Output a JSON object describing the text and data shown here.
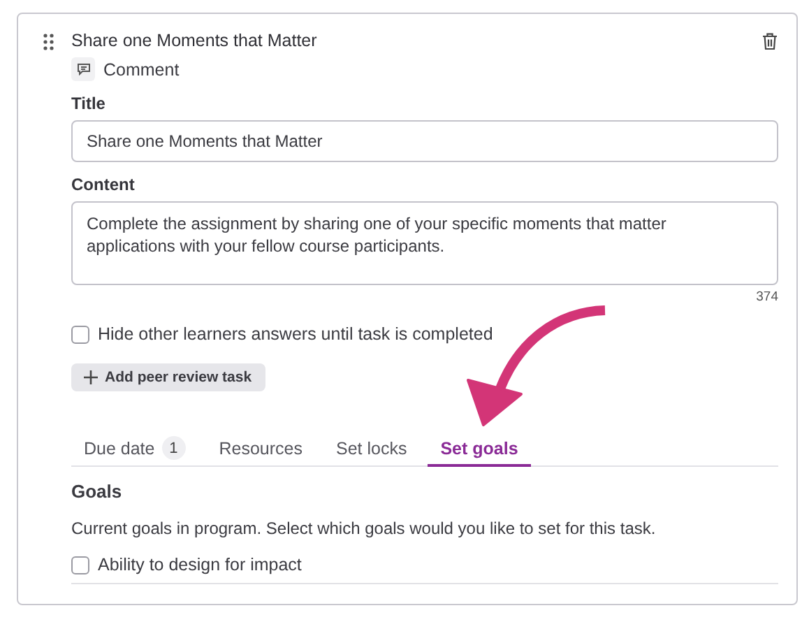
{
  "header": {
    "title": "Share one Moments that Matter",
    "type_label": "Comment"
  },
  "title_field": {
    "label": "Title",
    "value": "Share one Moments that Matter"
  },
  "content_field": {
    "label": "Content",
    "value": "Complete the assignment by sharing one of your specific moments that matter applications with your fellow course participants.",
    "count": "374"
  },
  "hide_answers": {
    "label": "Hide other learners answers until task is completed",
    "checked": false
  },
  "add_button": {
    "label": "Add peer review task"
  },
  "tabs": [
    {
      "label": "Due date",
      "badge": "1",
      "selected": false
    },
    {
      "label": "Resources",
      "selected": false
    },
    {
      "label": "Set locks",
      "selected": false
    },
    {
      "label": "Set goals",
      "selected": true
    }
  ],
  "goals": {
    "heading": "Goals",
    "description": "Current goals in program. Select which goals would you like to set for this task.",
    "items": [
      {
        "label": "Ability to design for impact",
        "checked": false
      }
    ]
  }
}
